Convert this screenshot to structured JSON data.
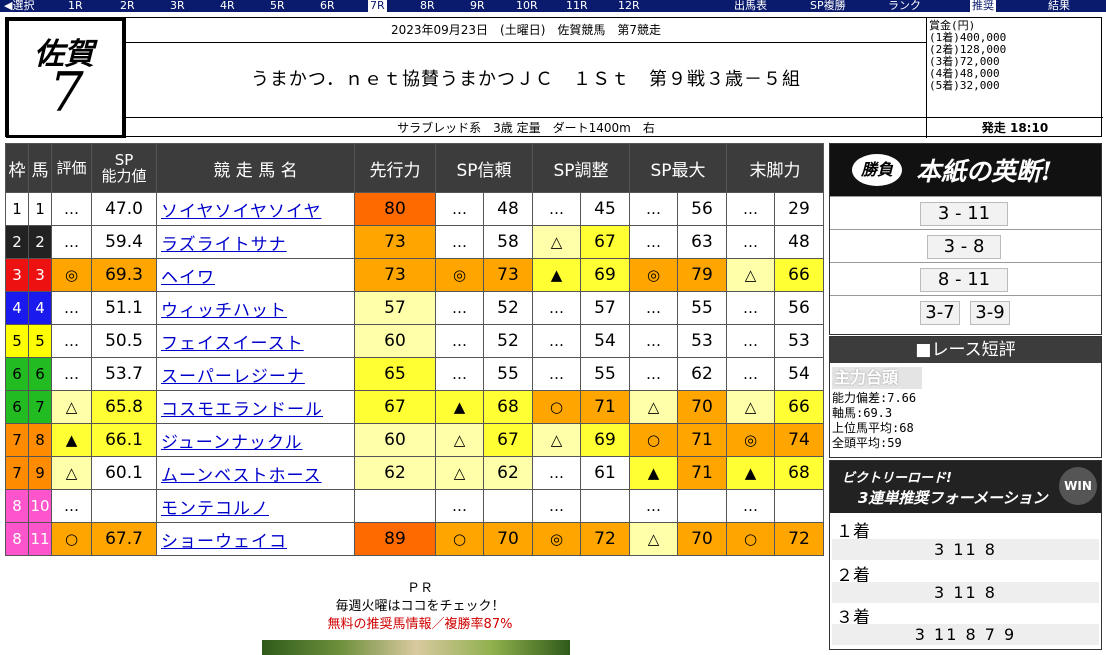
{
  "nav": {
    "items": [
      "◀選択",
      "1R",
      "2R",
      "3R",
      "4R",
      "5R",
      "6R",
      "7R",
      "8R",
      "9R",
      "10R",
      "11R",
      "12R"
    ],
    "selected": "7R",
    "right": [
      "出馬表",
      "SP複勝",
      "ランク",
      "推奨",
      "結果"
    ],
    "right_selected": "推奨"
  },
  "header": {
    "venue": "佐賀",
    "race_no": "7",
    "date_line": "2023年09月23日　(土曜日)　佐賀競馬　第7競走",
    "race_name": "うまかつ．ｎｅｔ協賛うまかつＪＣ　１Ｓｔ　第９戦３歳－５組",
    "conditions": "サラブレッド系　3歳 定量　ダート1400m　右",
    "prize_title": "賞金(円)",
    "prizes": [
      "(1着)400,000",
      "(2着)128,000",
      "(3着)72,000",
      "(4着)48,000",
      "(5着)32,000"
    ],
    "start": "発走 18:10"
  },
  "table": {
    "headers": [
      "枠",
      "馬",
      "評価",
      "SP\n能力値",
      "競 走 馬 名",
      "先行力",
      "SP信頼",
      "SP調整",
      "SP最大",
      "末脚力"
    ],
    "rows": [
      {
        "waku": "1",
        "uma": "1",
        "eval": "…",
        "sp": "47.0",
        "name": "ソイヤソイヤソイヤ",
        "sen": "80",
        "shin_m": "…",
        "shin": "48",
        "cho_m": "…",
        "cho": "45",
        "sai_m": "…",
        "sai": "56",
        "matsu_m": "…",
        "matsu": "29"
      },
      {
        "waku": "2",
        "uma": "2",
        "eval": "…",
        "sp": "59.4",
        "name": "ラズライトサナ",
        "sen": "73",
        "shin_m": "…",
        "shin": "58",
        "cho_m": "△",
        "cho": "67",
        "sai_m": "…",
        "sai": "63",
        "matsu_m": "…",
        "matsu": "48"
      },
      {
        "waku": "3",
        "uma": "3",
        "eval": "◎",
        "sp": "69.3",
        "name": "ヘイワ",
        "sen": "73",
        "shin_m": "◎",
        "shin": "73",
        "cho_m": "▲",
        "cho": "69",
        "sai_m": "◎",
        "sai": "79",
        "matsu_m": "△",
        "matsu": "66"
      },
      {
        "waku": "4",
        "uma": "4",
        "eval": "…",
        "sp": "51.1",
        "name": "ウィッチハット",
        "sen": "57",
        "shin_m": "…",
        "shin": "52",
        "cho_m": "…",
        "cho": "57",
        "sai_m": "…",
        "sai": "55",
        "matsu_m": "…",
        "matsu": "56"
      },
      {
        "waku": "5",
        "uma": "5",
        "eval": "…",
        "sp": "50.5",
        "name": "フェイスイースト",
        "sen": "60",
        "shin_m": "…",
        "shin": "52",
        "cho_m": "…",
        "cho": "54",
        "sai_m": "…",
        "sai": "53",
        "matsu_m": "…",
        "matsu": "53"
      },
      {
        "waku": "6",
        "uma": "6",
        "eval": "…",
        "sp": "53.7",
        "name": "スーパーレジーナ",
        "sen": "65",
        "shin_m": "…",
        "shin": "55",
        "cho_m": "…",
        "cho": "55",
        "sai_m": "…",
        "sai": "62",
        "matsu_m": "…",
        "matsu": "54"
      },
      {
        "waku": "6",
        "uma": "7",
        "eval": "△",
        "sp": "65.8",
        "name": "コスモエランドール",
        "sen": "67",
        "shin_m": "▲",
        "shin": "68",
        "cho_m": "○",
        "cho": "71",
        "sai_m": "△",
        "sai": "70",
        "matsu_m": "△",
        "matsu": "66"
      },
      {
        "waku": "7",
        "uma": "8",
        "eval": "▲",
        "sp": "66.1",
        "name": "ジューンナックル",
        "sen": "60",
        "shin_m": "△",
        "shin": "67",
        "cho_m": "△",
        "cho": "69",
        "sai_m": "○",
        "sai": "71",
        "matsu_m": "◎",
        "matsu": "74"
      },
      {
        "waku": "7",
        "uma": "9",
        "eval": "△",
        "sp": "60.1",
        "name": "ムーンベストホース",
        "sen": "62",
        "shin_m": "△",
        "shin": "62",
        "cho_m": "…",
        "cho": "61",
        "sai_m": "▲",
        "sai": "71",
        "matsu_m": "▲",
        "matsu": "68"
      },
      {
        "waku": "8",
        "uma": "10",
        "eval": "…",
        "sp": "",
        "name": "モンテコルノ",
        "sen": "",
        "shin_m": "…",
        "shin": "",
        "cho_m": "…",
        "cho": "",
        "sai_m": "…",
        "sai": "",
        "matsu_m": "…",
        "matsu": ""
      },
      {
        "waku": "8",
        "uma": "11",
        "eval": "○",
        "sp": "67.7",
        "name": "ショーウェイコ",
        "sen": "89",
        "shin_m": "○",
        "shin": "70",
        "cho_m": "◎",
        "cho": "72",
        "sai_m": "△",
        "sai": "70",
        "matsu_m": "○",
        "matsu": "72"
      }
    ],
    "waku_colors": {
      "1": "#ffffff",
      "2": "#222222",
      "3": "#ee1111",
      "4": "#1a1aee",
      "5": "#ffff00",
      "6": "#22bb22",
      "7": "#ff8c00",
      "8": "#ff55cc"
    },
    "waku_text_colors": {
      "1": "#000000",
      "2": "#ffffff",
      "3": "#ffffff",
      "4": "#ffffff",
      "5": "#000000",
      "6": "#000000",
      "7": "#000000",
      "8": "#ffffff"
    },
    "heat_colors": {
      "top": "#ff6a00",
      "high": "#ffa500",
      "mid": "#ffff33",
      "low": "#ffffaa"
    }
  },
  "picks": {
    "banner_badge": "勝負",
    "banner_title": "本紙の英断!",
    "rows": [
      [
        "3 - 11"
      ],
      [
        "3 - 8"
      ],
      [
        "8 - 11"
      ],
      [
        "3-7",
        "3-9"
      ]
    ]
  },
  "review": {
    "heading": "■レース短評",
    "tag": "主力台頭",
    "lines": [
      "能力偏差:7.66",
      "軸馬:69.3",
      "上位馬平均:68",
      "全頭平均:59"
    ]
  },
  "victory": {
    "line1": "ビクトリーロード!",
    "line2": "3連単推奨フォーメーション",
    "win": "WIN",
    "formation": [
      {
        "label": "１着",
        "values": "3 11 8"
      },
      {
        "label": "２着",
        "values": "3 11 8"
      },
      {
        "label": "３着",
        "values": "3 11 8 7 9"
      }
    ]
  },
  "pr": {
    "title": "ＰＲ",
    "line1": "毎週火曜はココをチェック！",
    "line2": "無料の推奨馬情報／複勝率87%"
  }
}
